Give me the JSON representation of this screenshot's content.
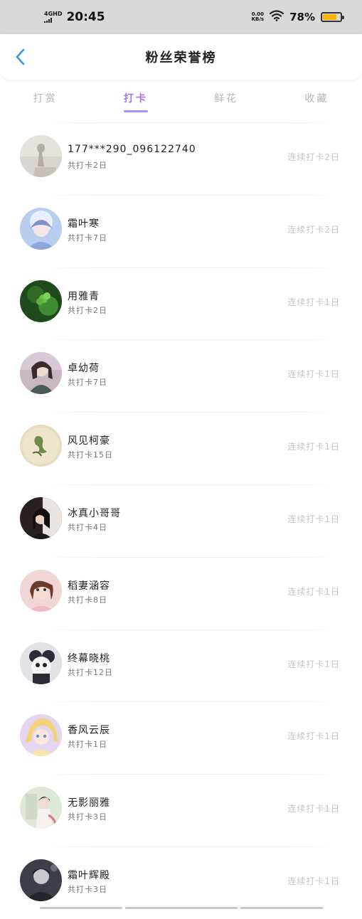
{
  "status_bar": {
    "network": "4GHD",
    "time": "20:45",
    "speed_value": "0.00",
    "speed_unit": "KB/s",
    "battery_percent": "78%",
    "battery_level": 0.78,
    "battery_color": "#f5b300",
    "icons": [
      "signal-icon",
      "wifi-icon",
      "battery-icon"
    ]
  },
  "header": {
    "title": "粉丝荣誉榜",
    "back_icon": "chevron-left-icon",
    "accent": "#3a9bdc"
  },
  "tabs": [
    {
      "label": "打赏",
      "active": false
    },
    {
      "label": "打卡",
      "active": true
    },
    {
      "label": "鲜花",
      "active": false
    },
    {
      "label": "收藏",
      "active": false
    }
  ],
  "active_tab_color": "#a677de",
  "fans": [
    {
      "name": "177***290_096122740",
      "total": "共打卡2日",
      "streak": "连续打卡2日",
      "avatar": "avatar-1"
    },
    {
      "name": "霜叶寒",
      "total": "共打卡7日",
      "streak": "连续打卡2日",
      "avatar": "avatar-2"
    },
    {
      "name": "用雅青",
      "total": "共打卡2日",
      "streak": "连续打卡1日",
      "avatar": "avatar-3"
    },
    {
      "name": "卓幼荷",
      "total": "共打卡7日",
      "streak": "连续打卡1日",
      "avatar": "avatar-4"
    },
    {
      "name": "风见柯豪",
      "total": "共打卡15日",
      "streak": "连续打卡1日",
      "avatar": "avatar-5"
    },
    {
      "name": "冰真小哥哥",
      "total": "共打卡4日",
      "streak": "连续打卡1日",
      "avatar": "avatar-6"
    },
    {
      "name": "稻妻涵容",
      "total": "共打卡8日",
      "streak": "连续打卡1日",
      "avatar": "avatar-7"
    },
    {
      "name": "终幕晓桃",
      "total": "共打卡12日",
      "streak": "连续打卡1日",
      "avatar": "avatar-8"
    },
    {
      "name": "香风云辰",
      "total": "共打卡1日",
      "streak": "连续打卡1日",
      "avatar": "avatar-9"
    },
    {
      "name": "无影丽雅",
      "total": "共打卡3日",
      "streak": "连续打卡1日",
      "avatar": "avatar-10"
    },
    {
      "name": "霜叶辉殿",
      "total": "共打卡3日",
      "streak": "连续打卡1日",
      "avatar": "avatar-11"
    }
  ]
}
